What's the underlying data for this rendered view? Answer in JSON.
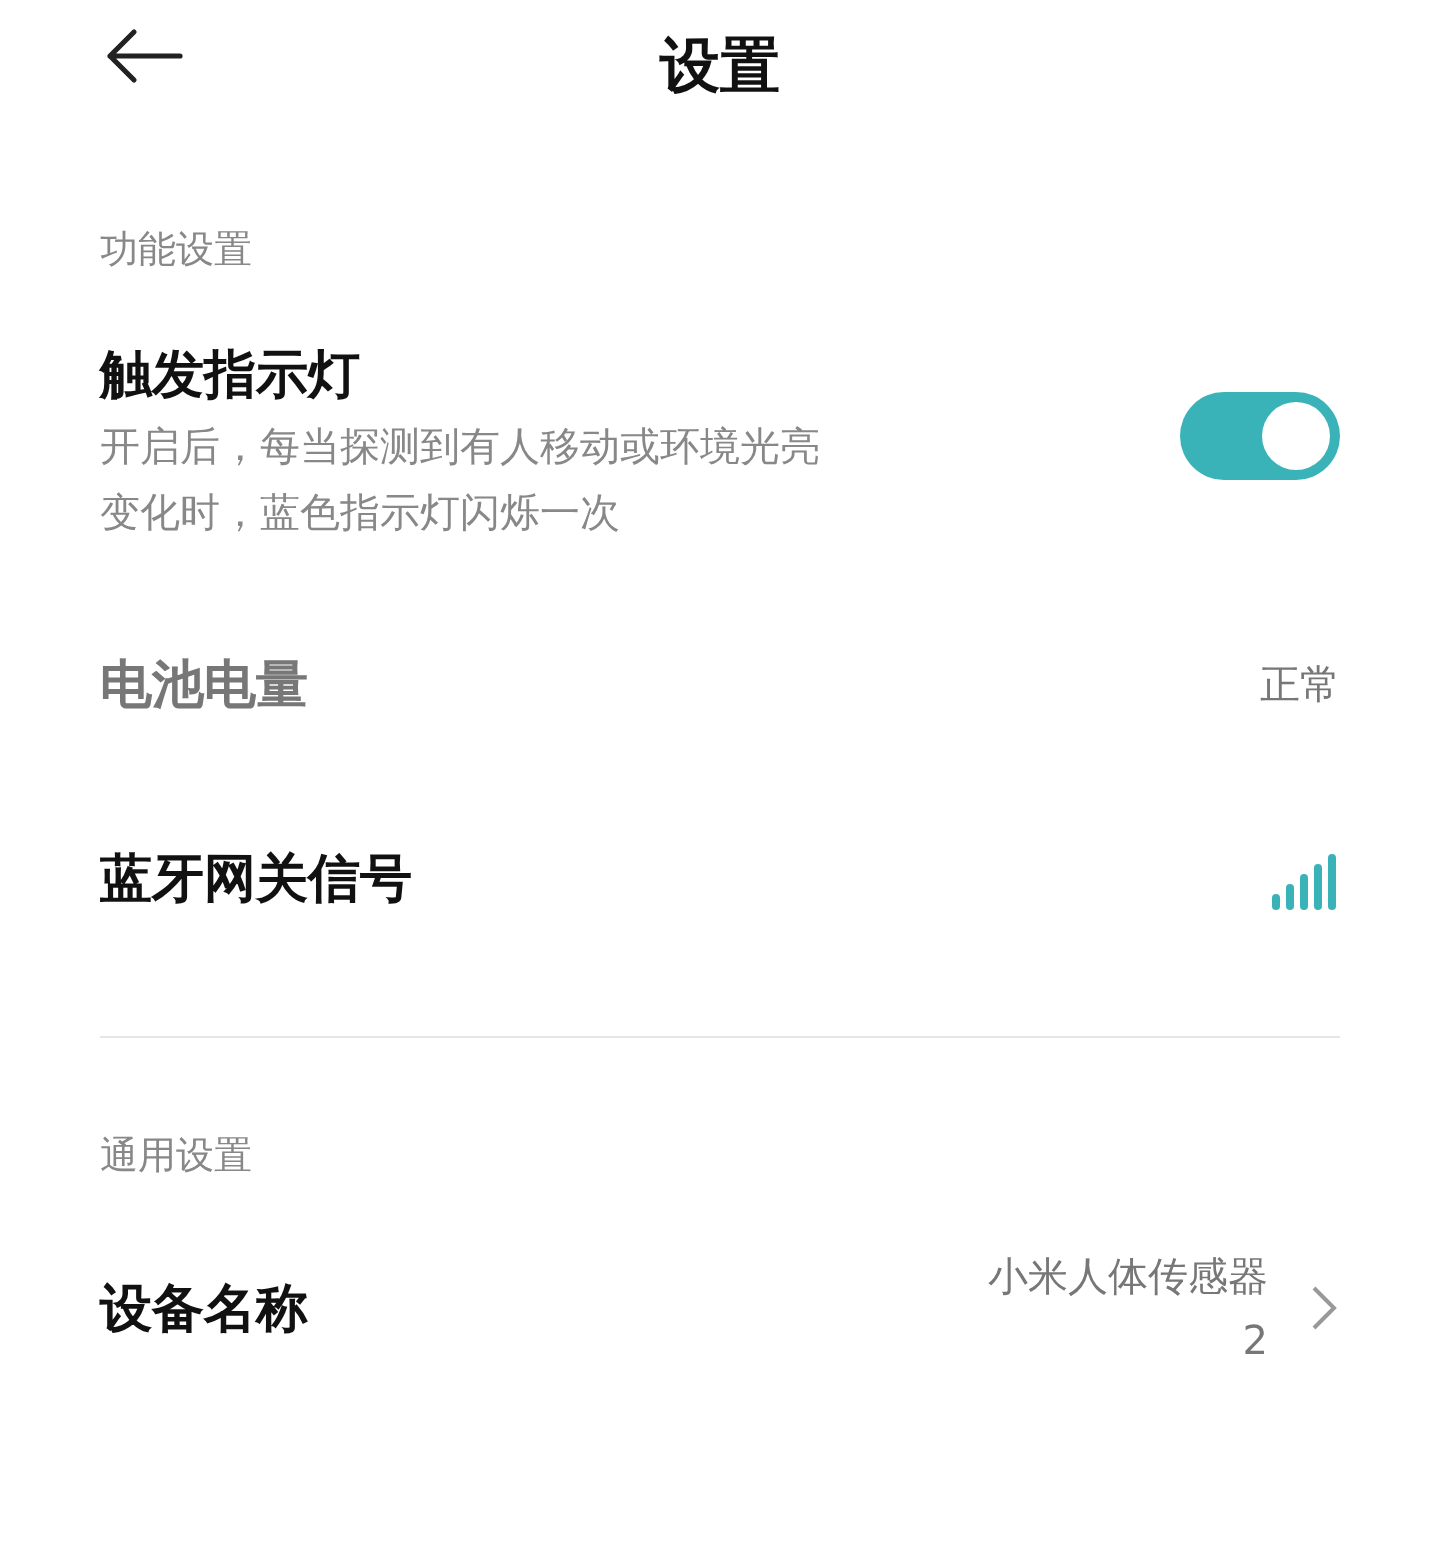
{
  "header": {
    "title": "设置"
  },
  "sections": [
    {
      "label": "功能设置",
      "items": [
        {
          "kind": "toggle",
          "title": "触发指示灯",
          "description": "开启后，每当探测到有人移动或环境光亮变化时，蓝色指示灯闪烁一次",
          "on": true
        },
        {
          "kind": "value",
          "title": "电池电量",
          "value": "正常"
        },
        {
          "kind": "signal",
          "title": "蓝牙网关信号"
        }
      ]
    },
    {
      "label": "通用设置",
      "items": [
        {
          "kind": "link",
          "title": "设备名称",
          "value": "小米人体传感器 2"
        }
      ]
    }
  ]
}
